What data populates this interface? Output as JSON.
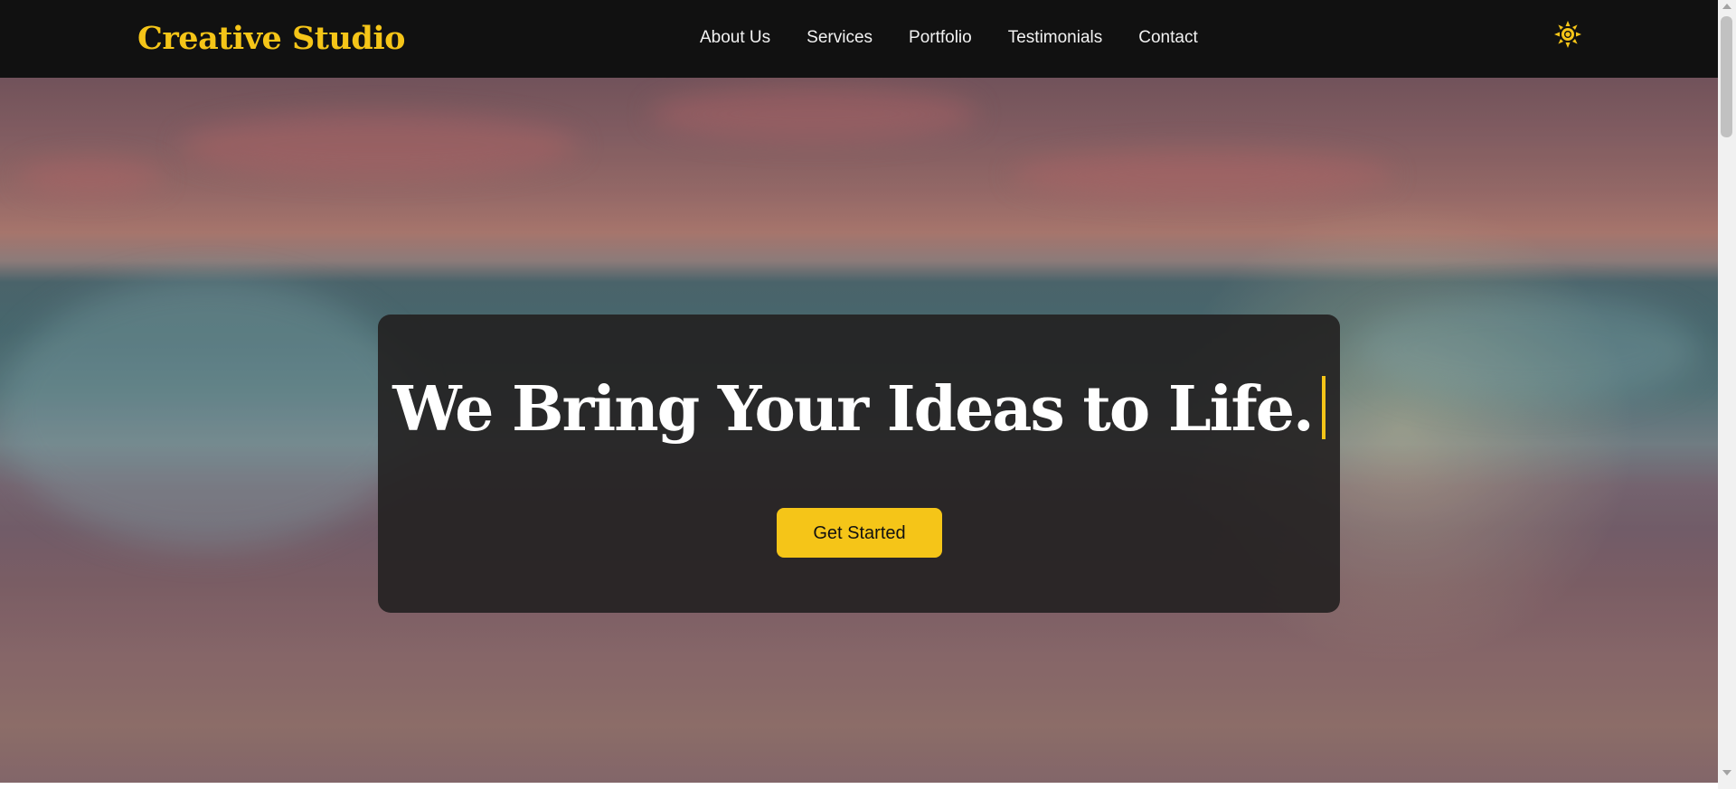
{
  "navbar": {
    "brand": "Creative Studio",
    "links": [
      {
        "label": "About Us"
      },
      {
        "label": "Services"
      },
      {
        "label": "Portfolio"
      },
      {
        "label": "Testimonials"
      },
      {
        "label": "Contact"
      }
    ],
    "theme_toggle_icon": "sun-icon"
  },
  "hero": {
    "title": "We Bring Your Ideas to Life.",
    "cta_label": "Get Started"
  },
  "colors": {
    "accent": "#f5c518",
    "navbar_bg": "#111111",
    "card_bg": "#222020",
    "text_light": "#ffffff"
  }
}
